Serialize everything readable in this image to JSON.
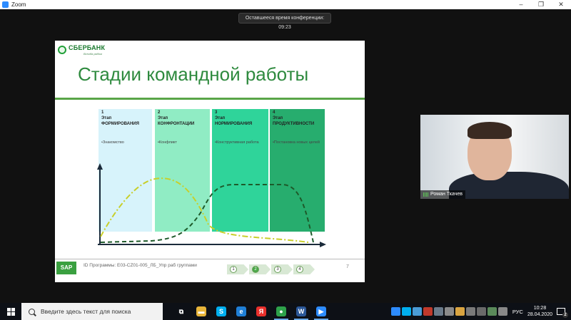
{
  "window": {
    "title": "Zoom",
    "minimize": "–",
    "maximize": "❐",
    "close": "✕"
  },
  "meeting": {
    "timer_text": "Оставшееся время конференции: 09:23"
  },
  "slide": {
    "logo_text": "СБЕРБАНК",
    "logo_subtext": "Всегда рядом",
    "title": "Стадии командной работы",
    "stages": [
      {
        "num": "1",
        "title": "Этап ФОРМИРОВАНИЯ",
        "bullet": "•Знакомство",
        "color": "#d7f3fb"
      },
      {
        "num": "2",
        "title": "Этап КОНФРОНТАЦИИ",
        "bullet": "•Конфликт",
        "color": "#90ecc4"
      },
      {
        "num": "3",
        "title": "Этап НОРМИРОВАНИЯ",
        "bullet": "•Конструктивная работа",
        "color": "#2fd49a"
      },
      {
        "num": "4",
        "title": "Этап ПРОДУКТИВНОСТИ",
        "bullet": "•Постановка новых целей",
        "color": "#27ad6e"
      }
    ],
    "footer_logo": "SAP",
    "footer_text": "ID Программы: Е03-CZ01-005_ЛБ_Упр раб группами",
    "steps": [
      "1",
      "2",
      "3",
      "4"
    ],
    "active_step": 2,
    "page_number": "7"
  },
  "webcam": {
    "participant_name": "Роман Ткачев"
  },
  "taskbar": {
    "search_placeholder": "Введите здесь текст для поиска",
    "apps": [
      {
        "name": "task-view",
        "glyph": "⧉",
        "color": "#0d1016"
      },
      {
        "name": "file-explorer",
        "glyph": "▬",
        "color": "#e8b53a"
      },
      {
        "name": "skype",
        "glyph": "S",
        "color": "#00aff0"
      },
      {
        "name": "edge",
        "glyph": "e",
        "color": "#1f7fd6"
      },
      {
        "name": "yandex",
        "glyph": "Я",
        "color": "#e9302c"
      },
      {
        "name": "chrome",
        "glyph": "●",
        "color": "#2ea24a"
      },
      {
        "name": "word",
        "glyph": "W",
        "color": "#2b5797"
      },
      {
        "name": "zoom",
        "glyph": "▶",
        "color": "#2d8cff"
      }
    ],
    "language": "РУС",
    "time": "10:28",
    "date": "28.04.2020",
    "notification_count": "2"
  }
}
